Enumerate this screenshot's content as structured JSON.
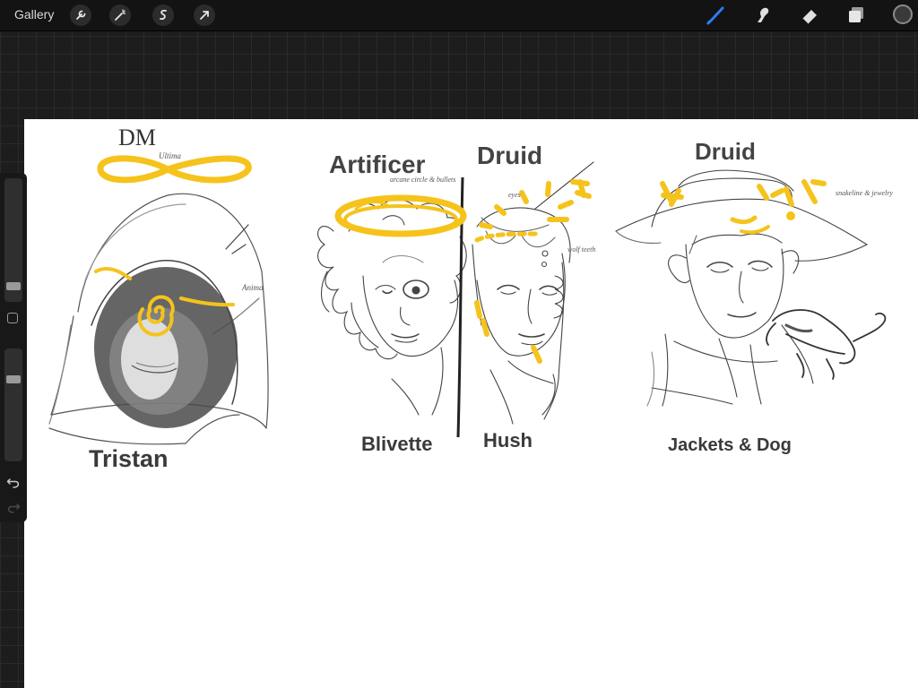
{
  "topbar": {
    "gallery_label": "Gallery",
    "left_tools": [
      "wrench-icon",
      "magic-wand-icon",
      "selection-icon",
      "transform-arrow-icon"
    ],
    "right_tools": [
      "brush-icon",
      "smudge-icon",
      "eraser-icon",
      "layers-icon",
      "color-swatch"
    ],
    "active_tool": "brush",
    "active_tool_color": "#2a7bf6",
    "current_color": "#3a3a3a"
  },
  "sidebar": {
    "brush_size_level": 0.15,
    "opacity_level": 0.7,
    "buttons": [
      "modify-button",
      "undo-icon",
      "redo-icon"
    ]
  },
  "canvas": {
    "background": "#ffffff",
    "highlight_color": "#f5c31b",
    "labels": {
      "dm": "DM",
      "ultima": "Ultima",
      "anima": "Anima",
      "tristan": "Tristan",
      "artificer": "Artificer",
      "arcane_circle": "arcane circle & bullets",
      "druid1": "Druid",
      "eyes": "eyes",
      "wolf_teeth": "wolf teeth",
      "blivette": "Blivette",
      "hush": "Hush",
      "druid2": "Druid",
      "snakeline": "snakeline & jewelry",
      "jackets_dog": "Jackets & Dog"
    }
  }
}
